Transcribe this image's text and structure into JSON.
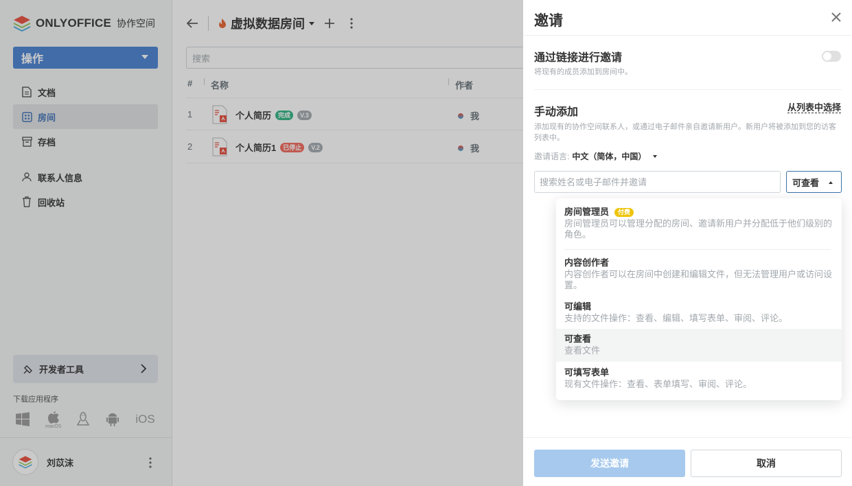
{
  "app": {
    "logo_text": "ONLYOFFICE",
    "logo_sub": "协作空间",
    "action_label": "操作",
    "nav": [
      {
        "label": "文档",
        "icon": "document-icon"
      },
      {
        "label": "房间",
        "icon": "rooms-icon"
      },
      {
        "label": "存档",
        "icon": "archive-icon"
      },
      {
        "label": "联系人信息",
        "icon": "contacts-icon"
      },
      {
        "label": "回收站",
        "icon": "trash-icon"
      }
    ],
    "dev_tools_label": "开发者工具",
    "download_label": "下载应用程序",
    "download_platforms": [
      "windows-icon",
      "macos-icon",
      "linux-icon",
      "android-icon"
    ],
    "ios_label": "iOS",
    "macos_label": "macOS",
    "user_name": "刘苡沫"
  },
  "room": {
    "title": "虚拟数据房间",
    "search_placeholder": "搜索",
    "columns": {
      "num": "#",
      "name": "名称",
      "author": "作者"
    },
    "rows": [
      {
        "num": "1",
        "name": "个人简历",
        "status": "完成",
        "version": "V.3",
        "author": "我"
      },
      {
        "num": "2",
        "name": "个人简历1",
        "status": "已停止",
        "version": "V.2",
        "author": "我"
      }
    ]
  },
  "invite": {
    "title": "邀请",
    "link_title": "通过链接进行邀请",
    "link_desc": "将现有的成员添加到房间中。",
    "manual_title": "手动添加",
    "choose_from_list": "从列表中选择",
    "manual_desc": "添加现有的协作空间联系人，或通过电子邮件亲自邀请新用户。新用户将被添加到您的访客列表中。",
    "lang_label": "邀请语言:",
    "lang_value": "中文（简体，中国）",
    "input_placeholder": "搜索姓名或电子邮件并邀请",
    "selected_role": "可查看",
    "roles": [
      {
        "name": "房间管理员",
        "paid": "付费",
        "desc": "房间管理员可以管理分配的房间、邀请新用户并分配低于他们级别的角色。"
      },
      {
        "name": "内容创作者",
        "desc": "内容创作者可以在房间中创建和编辑文件，但无法管理用户或访问设置。"
      },
      {
        "name": "可编辑",
        "desc": "支持的文件操作：查看、编辑、填写表单、审阅、评论。"
      },
      {
        "name": "可查看",
        "desc": "查看文件"
      },
      {
        "name": "可填写表单",
        "desc": "现有文件操作：查看、表单填写、审阅、评论。"
      }
    ],
    "send_label": "发送邀请",
    "cancel_label": "取消"
  },
  "colors": {
    "accent": "#4781d1",
    "send_disabled": "#a6c9ed",
    "paid_badge": "#edc409",
    "done_badge": "#2db482",
    "stopped_badge": "#f2675a"
  }
}
